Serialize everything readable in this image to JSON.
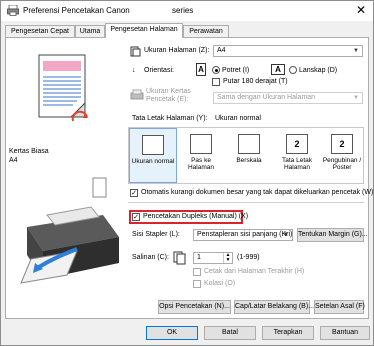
{
  "window": {
    "title": "Preferensi Pencetakan Canon ",
    "title_suffix": "series",
    "close_glyph": "✕"
  },
  "tabs": [
    {
      "label": "Pengesetan Cepat"
    },
    {
      "label": "Utama"
    },
    {
      "label": "Pengesetan Halaman"
    },
    {
      "label": "Perawatan"
    }
  ],
  "preview": {
    "media_type": "Kertas Biasa",
    "paper_size": "A4"
  },
  "page_size": {
    "label": "Ukuran Halaman (Z):",
    "value": "A4"
  },
  "orientation": {
    "label": "Orientasi:",
    "portrait": "Potret (I)",
    "landscape": "Lanskap (D)",
    "rotate": "Putar 180 derajat (T)",
    "portrait_icon": "A",
    "landscape_icon": "A"
  },
  "printer_paper_size": {
    "label_line1": "Ukuran Kertas",
    "label_line2": "Pencetak (E):",
    "value": "Sama dengan Ukuran Halaman"
  },
  "page_layout": {
    "label": "Tata Letak Halaman (Y):",
    "value": "Ukuran normal",
    "options": [
      {
        "line1": "Ukuran normal",
        "line2": ""
      },
      {
        "line1": "Pas ke",
        "line2": "Halaman"
      },
      {
        "line1": "Berskala",
        "line2": ""
      },
      {
        "line1": "Tata Letak",
        "line2": "Halaman"
      },
      {
        "line1": "Pengubinan /",
        "line2": "Poster"
      }
    ],
    "badge_2": "2"
  },
  "auto_reduce": {
    "label": "Otomatis kurangi dokumen besar yang tak dapat dikeluarkan pencetak (W)",
    "check": "✓"
  },
  "duplex": {
    "label": "Pencetakan Dupleks (Manual) (X)",
    "check": "✓"
  },
  "stapling": {
    "label": "Sisi Stapler (L):",
    "value": "Penstapleran sisi panjang (Kri)",
    "margin_button": "Tentukan Margin (G)..."
  },
  "copies": {
    "label": "Salinan (C):",
    "value": "1",
    "range": "(1-999)",
    "last_page_first": "Cetak dari Halaman Terakhir (H)",
    "collate": "Kolasi (O)"
  },
  "bottom_buttons": {
    "print_options": "Opsi Pencetakan (N)...",
    "stamp": "Cap/Latar Belakang (B)...",
    "defaults": "Setelan Asal (F)"
  },
  "dialog_buttons": {
    "ok": "OK",
    "cancel": "Batal",
    "apply": "Terapkan",
    "help": "Bantuan"
  }
}
